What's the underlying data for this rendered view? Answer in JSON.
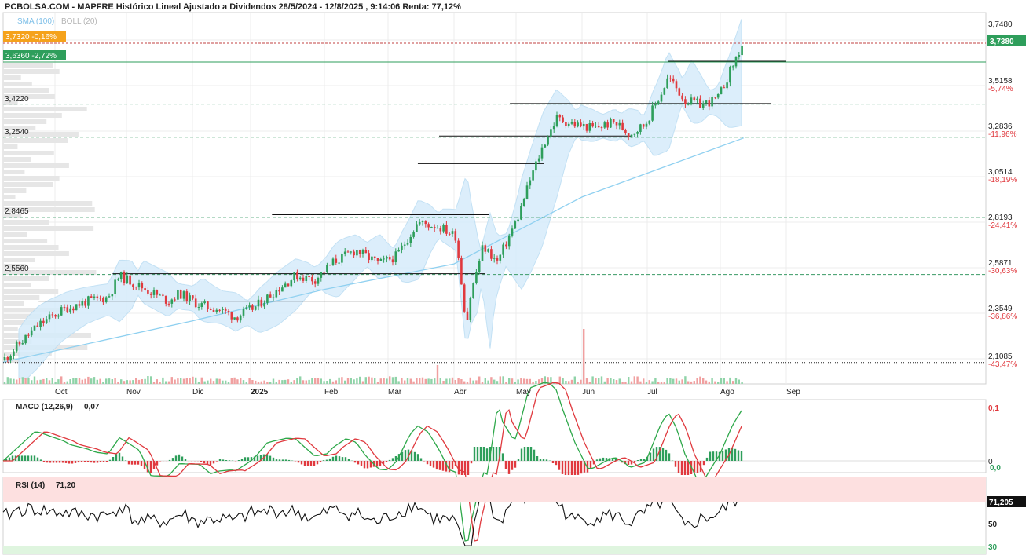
{
  "header": {
    "title": "PCBOLSA.COM - MAPFRE Histórico Lineal Ajustado a Dividendos 28/5/2024 - 12/8/2025 , 9:14:06 Renta: 77,12%",
    "legend_sma": "SMA (100)",
    "legend_boll": "BOLL (20)"
  },
  "colors": {
    "up": "#2e9e5b",
    "down": "#e0393e",
    "sma": "#8fd0f0",
    "boll_fill": "#d6ecfb",
    "boll_line": "#b9dcf3",
    "last_price_bg": "#2e9e5b",
    "first_tag_bg": "#f5a21b",
    "grid": "#ececec",
    "dashed": "#3a9a66",
    "red_text": "#e0393e",
    "macd_up_fill": "#b9e8b9",
    "macd_down_fill": "#f5b8b8",
    "rsi_over": "#fde0e0",
    "rsi_under": "#dff5df"
  },
  "price_panel": {
    "tag_first": "3,7320  -0,16%",
    "tag_second": "3,6360  -2,72%",
    "last_price_label": "3,7380",
    "level_labels": [
      "3,4220",
      "3,2540",
      "2,8465",
      "2,5560"
    ],
    "right_axis": [
      {
        "value": "3,7480",
        "pct": ""
      },
      {
        "value": "3,5158",
        "pct": "-5,74%"
      },
      {
        "value": "3,2836",
        "pct": "-11,96%"
      },
      {
        "value": "3,0514",
        "pct": "-18,19%"
      },
      {
        "value": "2,8193",
        "pct": "-24,41%"
      },
      {
        "value": "2,5871",
        "pct": "-30,63%"
      },
      {
        "value": "2,3549",
        "pct": "-36,86%"
      },
      {
        "value": "2,1085",
        "pct": "-43,47%"
      }
    ]
  },
  "months": [
    "Oct",
    "Nov",
    "Dic",
    "2025",
    "Feb",
    "Mar",
    "Abr",
    "May",
    "Jun",
    "Jul",
    "Ago",
    "Sep"
  ],
  "macd_panel": {
    "title": "MACD (12,26,9)",
    "value": "0,07",
    "axis": [
      "0,1",
      "0",
      "0,0"
    ]
  },
  "rsi_panel": {
    "title": "RSI (14)",
    "value": "71,20",
    "last_label": "71,205",
    "axis": [
      "50",
      "30"
    ]
  },
  "chart_data": {
    "type": "candlestick",
    "title": "PCBOLSA.COM - MAPFRE Histórico Lineal Ajustado a Dividendos 28/5/2024 - 12/8/2025 , 9:14:06 Renta: 77,12%",
    "y_range": [
      2.0,
      3.8
    ],
    "last_close": 3.738,
    "close_series": {
      "x": [
        "2024-09-12",
        "2024-09-25",
        "2024-10-05",
        "2024-10-15",
        "2024-10-24",
        "2024-10-29",
        "2024-11-10",
        "2024-11-20",
        "2024-11-25",
        "2024-12-05",
        "2024-12-15",
        "2024-12-24",
        "2025-01-03",
        "2025-01-10",
        "2025-01-20",
        "2025-01-28",
        "2025-02-05",
        "2025-02-15",
        "2025-02-25",
        "2025-03-05",
        "2025-03-15",
        "2025-03-25",
        "2025-04-02",
        "2025-04-07",
        "2025-04-09",
        "2025-04-15",
        "2025-04-22",
        "2025-04-28",
        "2025-05-02",
        "2025-05-08",
        "2025-05-14",
        "2025-05-20",
        "2025-05-28",
        "2025-06-06",
        "2025-06-16",
        "2025-06-23",
        "2025-06-30",
        "2025-07-07",
        "2025-07-10",
        "2025-07-17",
        "2025-07-24",
        "2025-07-31",
        "2025-08-06",
        "2025-08-12"
      ],
      "y": [
        2.12,
        2.3,
        2.38,
        2.42,
        2.44,
        2.55,
        2.48,
        2.42,
        2.46,
        2.4,
        2.38,
        2.34,
        2.39,
        2.46,
        2.55,
        2.53,
        2.62,
        2.68,
        2.61,
        2.65,
        2.82,
        2.8,
        2.75,
        2.3,
        2.45,
        2.7,
        2.62,
        2.76,
        2.85,
        3.05,
        3.22,
        3.35,
        3.32,
        3.3,
        3.33,
        3.27,
        3.32,
        3.48,
        3.56,
        3.44,
        3.42,
        3.45,
        3.6,
        3.738
      ]
    },
    "sma100": {
      "x": [
        "2024-09-12",
        "2024-12-01",
        "2025-02-01",
        "2025-04-01",
        "2025-06-01",
        "2025-08-12"
      ],
      "y": [
        2.11,
        2.32,
        2.48,
        2.61,
        2.95,
        3.25
      ]
    },
    "levels": [
      3.732,
      3.636,
      3.422,
      3.254,
      2.8465,
      2.556,
      2.1085
    ],
    "macd": {
      "current": 0.07,
      "axis_labels": [
        "0,1",
        "0",
        "0,0"
      ]
    },
    "rsi": {
      "current": 71.205,
      "overbought": 70,
      "oversold": 30
    }
  }
}
